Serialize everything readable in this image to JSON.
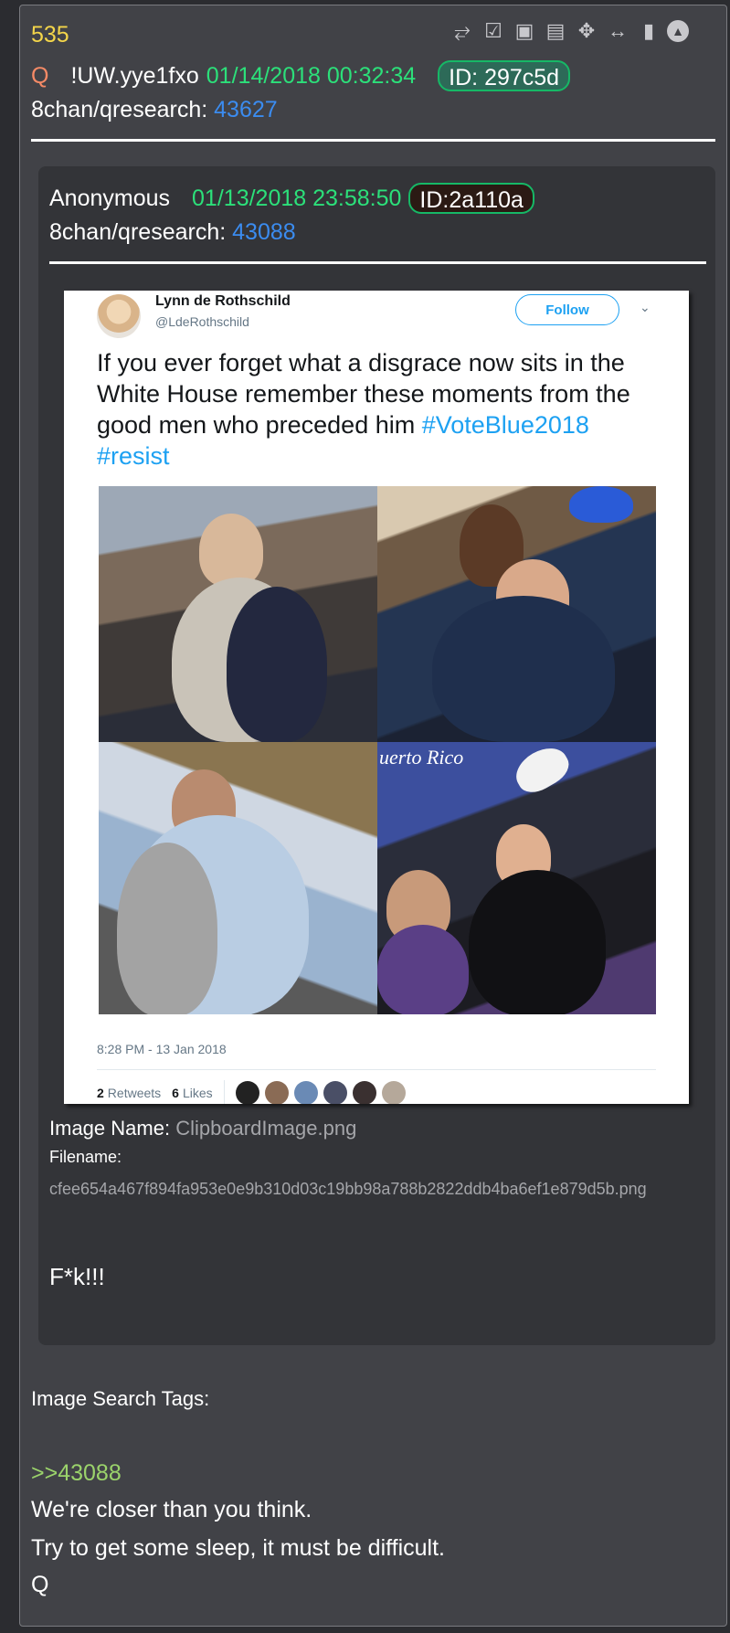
{
  "post": {
    "number": "535",
    "q_letter": "Q",
    "tripcode": "!UW.yye1fxo",
    "date": "01/14/2018 00:32:34",
    "id": "ID: 297c5d",
    "board": "8chan/qresearch:",
    "board_ref": "43627",
    "toolbar_icons": [
      "share-icon",
      "clipboard-check-icon",
      "vr-glasses-icon",
      "document-icon",
      "move-icon",
      "resize-horizontal-icon",
      "clipboard-icon",
      "up-arrow-icon"
    ]
  },
  "quoted": {
    "name": "Anonymous",
    "date": "01/13/2018 23:58:50",
    "id": "ID:2a110a",
    "board": "8chan/qresearch:",
    "board_ref": "43088",
    "tweet": {
      "name": "Lynn de Rothschild",
      "handle": "@LdeRothschild",
      "follow": "Follow",
      "text": "If you ever forget what a disgrace now sits in the White House remember these moments from the good men who preceded him",
      "hashtag1": "#VoteBlue2018",
      "hashtag2": "#resist",
      "timestamp": "8:28 PM - 13 Jan 2018",
      "retweets_count": "2",
      "retweets_label": "Retweets",
      "likes_count": "6",
      "likes_label": "Likes",
      "photo_sign": "uerto Rico"
    },
    "image_name_label": "Image Name:",
    "image_name": "ClipboardImage.png",
    "filename_label": "Filename:",
    "filename": "cfee654a467f894fa953e0e9b310d03c19bb98a788b2822ddb4ba6ef1e879d5b.png",
    "message": "F*k!!!"
  },
  "tags_label": "Image Search Tags:",
  "reply": {
    "link": ">>43088",
    "lines": [
      "We're closer than you think.",
      "Try to get some sleep, it must be difficult.",
      "Q"
    ]
  }
}
